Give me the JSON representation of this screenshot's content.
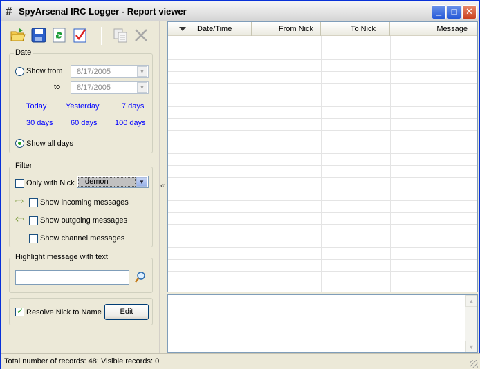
{
  "window": {
    "title": "SpyArsenal IRC Logger - Report viewer",
    "app_icon_glyph": "#",
    "controls": {
      "minimize": "_",
      "maximize": "□",
      "close": "✕"
    }
  },
  "toolbar": {
    "icons": [
      "open-folder-icon",
      "save-icon",
      "refresh-icon",
      "checklist-icon",
      "copy-icon",
      "delete-icon"
    ]
  },
  "date_group": {
    "label": "Date",
    "show_from_label": "Show from",
    "from_value": "8/17/2005",
    "to_label": "to",
    "to_value": "8/17/2005",
    "quick_links": [
      "Today",
      "Yesterday",
      "7 days",
      "30 days",
      "60 days",
      "100 days"
    ],
    "show_all_label": "Show all days",
    "show_all_selected": true,
    "show_from_selected": false
  },
  "filter_group": {
    "label": "Filter",
    "only_with_nick_label": "Only with Nick",
    "only_with_nick_checked": false,
    "nick_value": "demon",
    "show_incoming_label": "Show incoming messages",
    "show_outgoing_label": "Show outgoing messages",
    "show_channel_label": "Show channel messages",
    "show_incoming_checked": false,
    "show_outgoing_checked": false,
    "show_channel_checked": false
  },
  "highlight_group": {
    "label": "Highlight message with text",
    "value": ""
  },
  "resolve_group": {
    "resolve_label": "Resolve Nick to Name",
    "resolve_checked": true,
    "edit_label": "Edit"
  },
  "splitter": {
    "collapse_glyph": "«"
  },
  "grid": {
    "columns": [
      "Date/Time",
      "From Nick",
      "To Nick",
      "Message"
    ],
    "rows": []
  },
  "status": {
    "text": "Total number of records: 48; Visible records: 0"
  },
  "colors": {
    "link": "#0000ff",
    "accent_green": "#21a121",
    "window_bg": "#ece9d8"
  }
}
